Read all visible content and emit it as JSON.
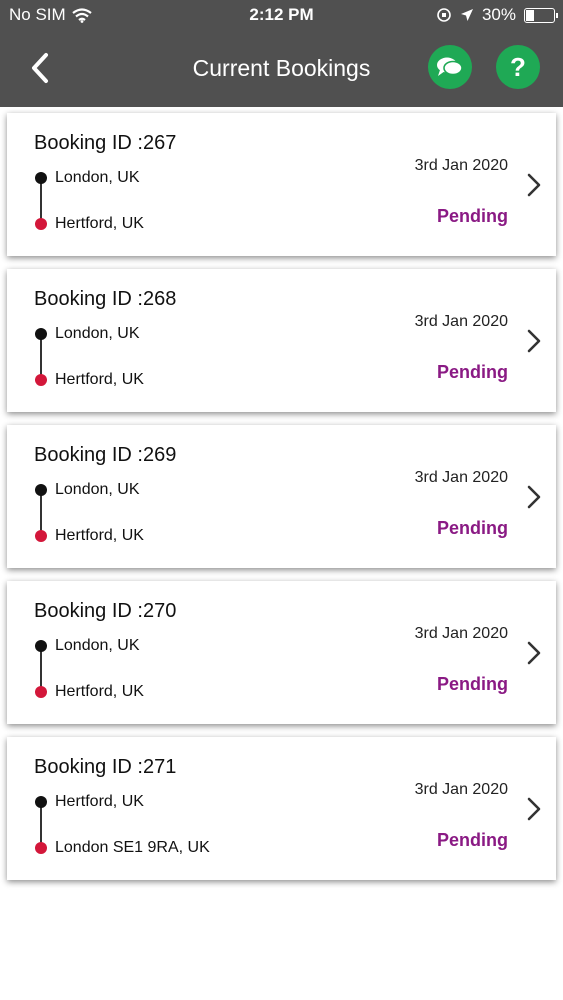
{
  "status_bar": {
    "carrier": "No SIM",
    "time": "2:12 PM",
    "battery": "30%",
    "battery_level": 0.3
  },
  "header": {
    "title": "Current Bookings"
  },
  "icons": {
    "back": "back-chevron-icon",
    "chat": "chat-bubbles-icon",
    "help": "question-mark-icon",
    "help_glyph": "?"
  },
  "colors": {
    "header_bg": "#505050",
    "accent_green": "#1fa955",
    "status_pending": "#8a1a84",
    "origin_dot": "#111111",
    "destination_dot": "#d3173a"
  },
  "bookings": [
    {
      "id": "Booking ID :267",
      "from": "London, UK",
      "to": "Hertford, UK",
      "date": "3rd Jan 2020",
      "status": "Pending"
    },
    {
      "id": "Booking ID :268",
      "from": "London, UK",
      "to": "Hertford, UK",
      "date": "3rd Jan 2020",
      "status": "Pending"
    },
    {
      "id": "Booking ID :269",
      "from": "London, UK",
      "to": "Hertford, UK",
      "date": "3rd Jan 2020",
      "status": "Pending"
    },
    {
      "id": "Booking ID :270",
      "from": "London, UK",
      "to": "Hertford, UK",
      "date": "3rd Jan 2020",
      "status": "Pending"
    },
    {
      "id": "Booking ID :271",
      "from": "Hertford, UK",
      "to": "London SE1 9RA, UK",
      "date": "3rd Jan 2020",
      "status": "Pending"
    }
  ]
}
